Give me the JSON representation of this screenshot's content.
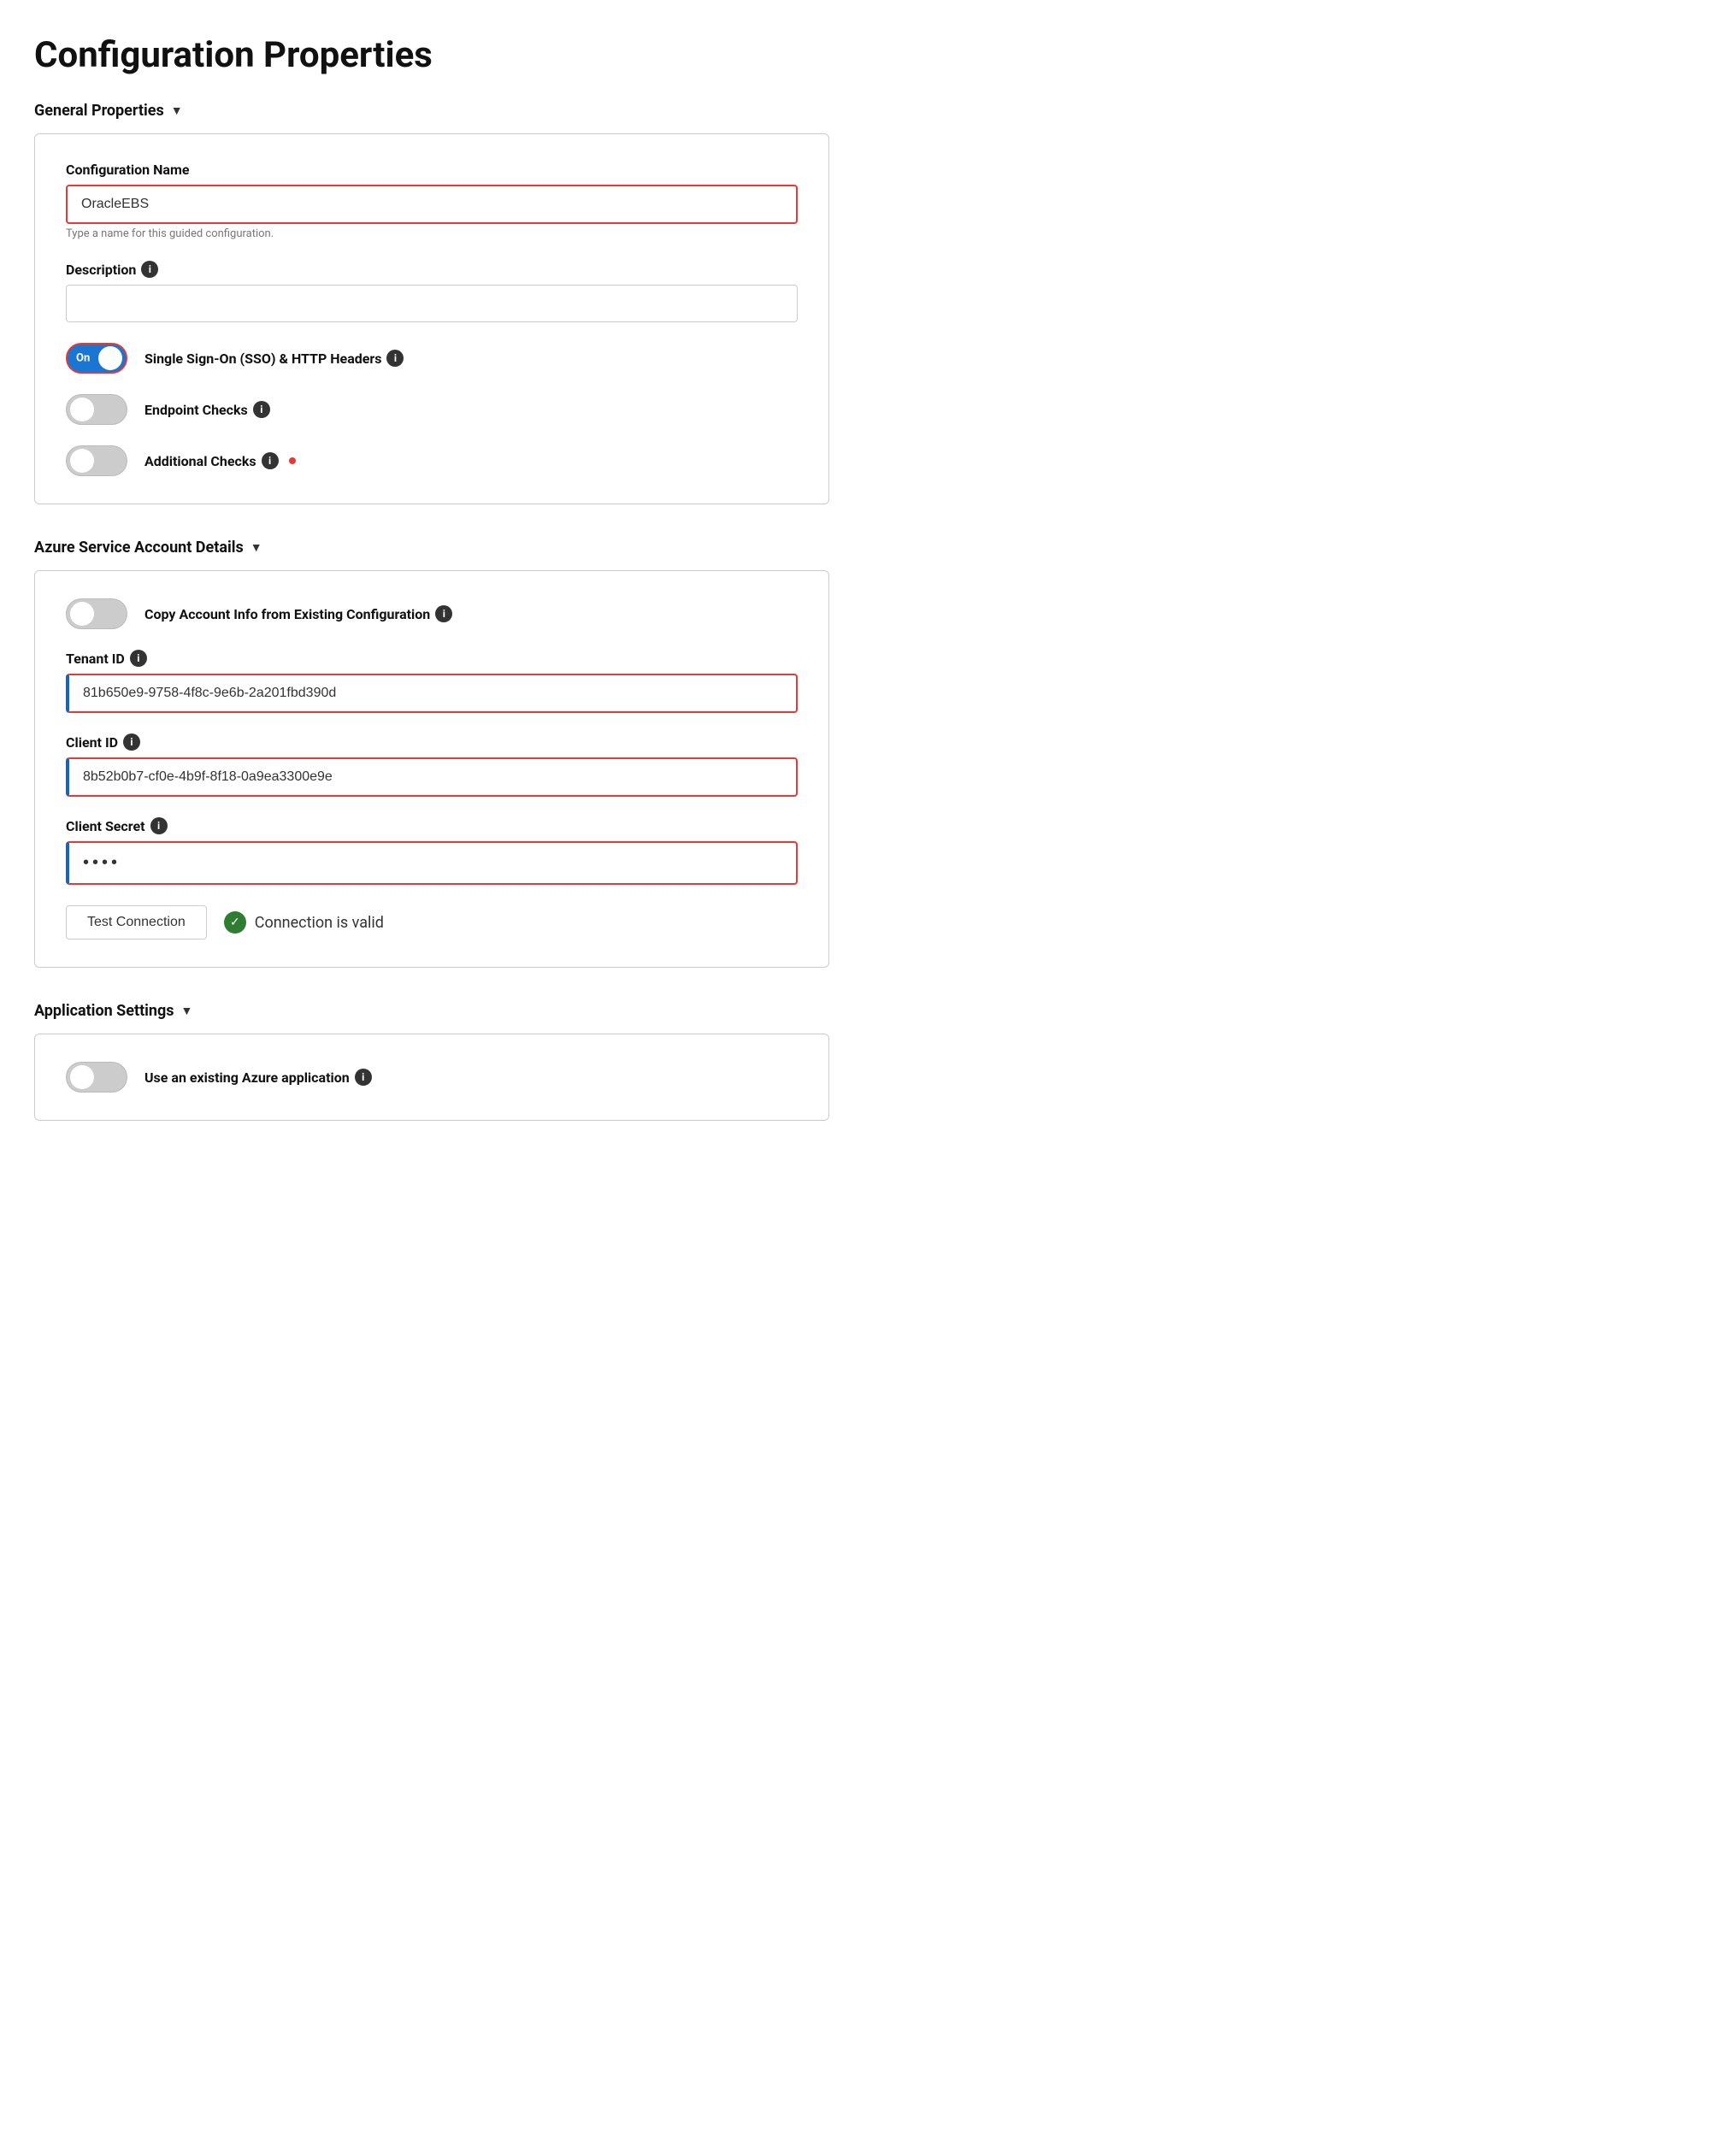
{
  "page": {
    "title": "Configuration Properties"
  },
  "sections": {
    "general": {
      "label": "General Properties",
      "chevron": "▼",
      "config_name_label": "Configuration Name",
      "config_name_value": "OracleEBS",
      "config_name_hint": "Type a name for this guided configuration.",
      "description_label": "Description",
      "description_info": "i",
      "sso_toggle_state": "on",
      "sso_toggle_text": "On",
      "sso_label": "Single Sign-On (SSO) & HTTP Headers",
      "sso_info": "i",
      "endpoint_label": "Endpoint Checks",
      "endpoint_info": "i",
      "additional_label": "Additional Checks",
      "additional_info": "i"
    },
    "azure": {
      "label": "Azure Service Account Details",
      "chevron": "▼",
      "copy_label": "Copy Account Info from Existing Configuration",
      "copy_info": "i",
      "tenant_id_label": "Tenant ID",
      "tenant_id_info": "i",
      "tenant_id_value": "81b650e9-9758-4f8c-9e6b-2a201fbd390d",
      "client_id_label": "Client ID",
      "client_id_info": "i",
      "client_id_value": "8b52b0b7-cf0e-4b9f-8f18-0a9ea3300e9e",
      "client_secret_label": "Client Secret",
      "client_secret_info": "i",
      "client_secret_value": "••••",
      "test_button_label": "Test Connection",
      "connection_valid_text": "Connection is valid",
      "valid_checkmark": "✓"
    },
    "app_settings": {
      "label": "Application Settings",
      "chevron": "▼",
      "use_azure_label": "Use an existing Azure application",
      "use_azure_info": "i"
    }
  }
}
